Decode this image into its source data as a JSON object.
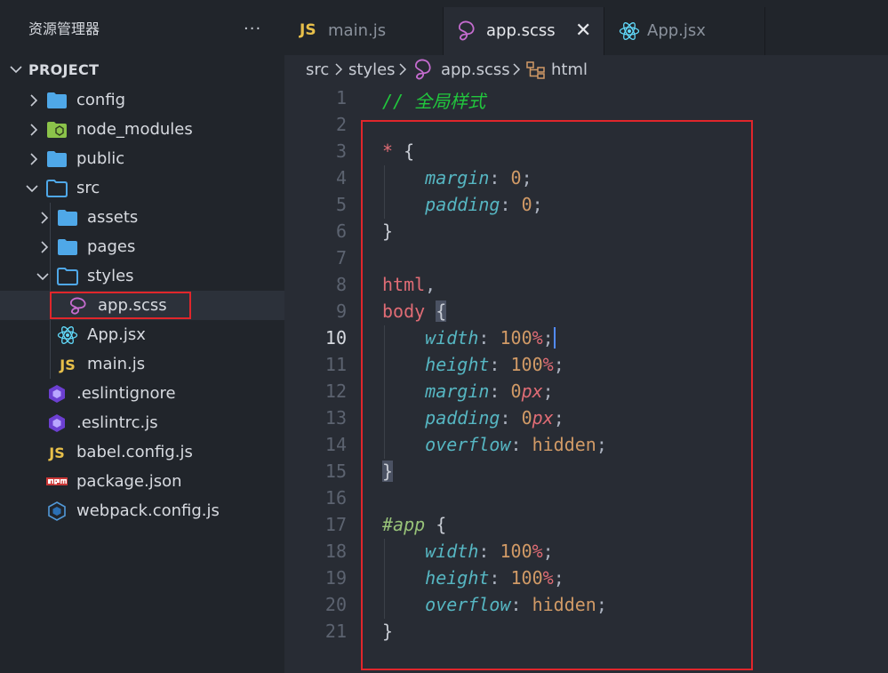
{
  "explorer": {
    "title": "资源管理器",
    "more": "···",
    "project_label": "PROJECT",
    "items": [
      {
        "label": "config"
      },
      {
        "label": "node_modules"
      },
      {
        "label": "public"
      },
      {
        "label": "src"
      },
      {
        "label": "assets"
      },
      {
        "label": "pages"
      },
      {
        "label": "styles"
      },
      {
        "label": "app.scss"
      },
      {
        "label": "App.jsx"
      },
      {
        "label": "main.js"
      },
      {
        "label": ".eslintignore"
      },
      {
        "label": ".eslintrc.js"
      },
      {
        "label": "babel.config.js"
      },
      {
        "label": "package.json"
      },
      {
        "label": "webpack.config.js"
      }
    ]
  },
  "tabs": [
    {
      "label": "main.js",
      "icon_text": "JS"
    },
    {
      "label": "app.scss"
    },
    {
      "label": "App.jsx"
    }
  ],
  "close_glyph": "✕",
  "breadcrumb": [
    "src",
    "styles",
    "app.scss",
    "html"
  ],
  "code": {
    "line_numbers": [
      "1",
      "2",
      "3",
      "4",
      "5",
      "6",
      "7",
      "8",
      "9",
      "10",
      "11",
      "12",
      "13",
      "14",
      "15",
      "16",
      "17",
      "18",
      "19",
      "20",
      "21"
    ],
    "comment": "// 全局样式",
    "t": {
      "star": "*",
      "ob": "{",
      "cb": "}",
      "colon": ":",
      "semi": ";",
      "comma": ",",
      "margin": "margin",
      "padding": "padding",
      "width": "width",
      "height": "height",
      "overflow": "overflow",
      "zero": "0",
      "hundred": "100",
      "pct": "%",
      "px": "px",
      "hidden": "hidden",
      "html": "html",
      "body": "body",
      "app": "#app"
    }
  },
  "colors": {
    "highlight_box": "#e0262b",
    "caret": "#528bff"
  }
}
